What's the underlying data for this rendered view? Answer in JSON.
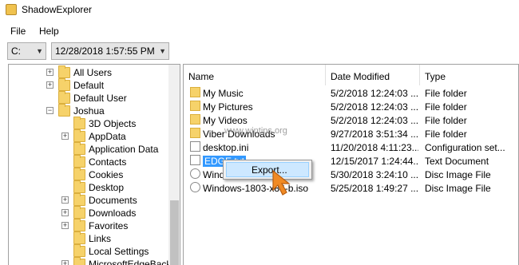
{
  "window": {
    "title": "ShadowExplorer"
  },
  "menu": [
    {
      "label": "File"
    },
    {
      "label": "Help"
    }
  ],
  "toolbar": {
    "drive": {
      "value": "C:"
    },
    "snapshot": {
      "value": "12/28/2018 1:57:55 PM"
    }
  },
  "tree": [
    {
      "label": "All Users",
      "expander": "+"
    },
    {
      "label": "Default",
      "expander": "+"
    },
    {
      "label": "Default User",
      "expander": ""
    },
    {
      "label": "Joshua",
      "expander": "−"
    },
    {
      "label": "3D Objects",
      "expander": ""
    },
    {
      "label": "AppData",
      "expander": "+"
    },
    {
      "label": "Application Data",
      "expander": ""
    },
    {
      "label": "Contacts",
      "expander": ""
    },
    {
      "label": "Cookies",
      "expander": ""
    },
    {
      "label": "Desktop",
      "expander": ""
    },
    {
      "label": "Documents",
      "expander": "+"
    },
    {
      "label": "Downloads",
      "expander": "+"
    },
    {
      "label": "Favorites",
      "expander": "+"
    },
    {
      "label": "Links",
      "expander": ""
    },
    {
      "label": "Local Settings",
      "expander": ""
    },
    {
      "label": "MicrosoftEdgeBacku",
      "expander": "+"
    }
  ],
  "list": {
    "columns": [
      {
        "label": "Name"
      },
      {
        "label": "Date Modified"
      },
      {
        "label": "Type"
      }
    ],
    "rows": [
      {
        "name": "My Music",
        "date": "5/2/2018 12:24:03 ...",
        "type": "File folder",
        "icon": "folder-icon"
      },
      {
        "name": "My Pictures",
        "date": "5/2/2018 12:24:03 ...",
        "type": "File folder",
        "icon": "folder-icon"
      },
      {
        "name": "My Videos",
        "date": "5/2/2018 12:24:03 ...",
        "type": "File folder",
        "icon": "folder-icon"
      },
      {
        "name": "Viber Downloads",
        "date": "9/27/2018 3:51:34 ...",
        "type": "File folder",
        "icon": "folder-icon"
      },
      {
        "name": "desktop.ini",
        "date": "11/20/2018 4:11:23...",
        "type": "Configuration set...",
        "icon": "file-icon"
      },
      {
        "name": "EDGE.txt",
        "date": "12/15/2017 1:24:44...",
        "type": "Text Document",
        "icon": "text-file-icon"
      },
      {
        "name": "Wind",
        "date": "5/30/2018 3:24:10 ...",
        "type": "Disc Image File",
        "icon": "disc-image-icon"
      },
      {
        "name": "Windows-1803-x86-b.iso",
        "date": "5/25/2018 1:49:27 ...",
        "type": "Disc Image File",
        "icon": "disc-image-icon"
      }
    ]
  },
  "context_menu": {
    "items": [
      {
        "label": "Export..."
      }
    ]
  },
  "watermark": {
    "text": "www.wintips.org"
  },
  "colors": {
    "selection": "#3399ff",
    "folder": "#f6d26a",
    "menu_highlight": "#cde8ff",
    "cursor": "#f08a24"
  }
}
